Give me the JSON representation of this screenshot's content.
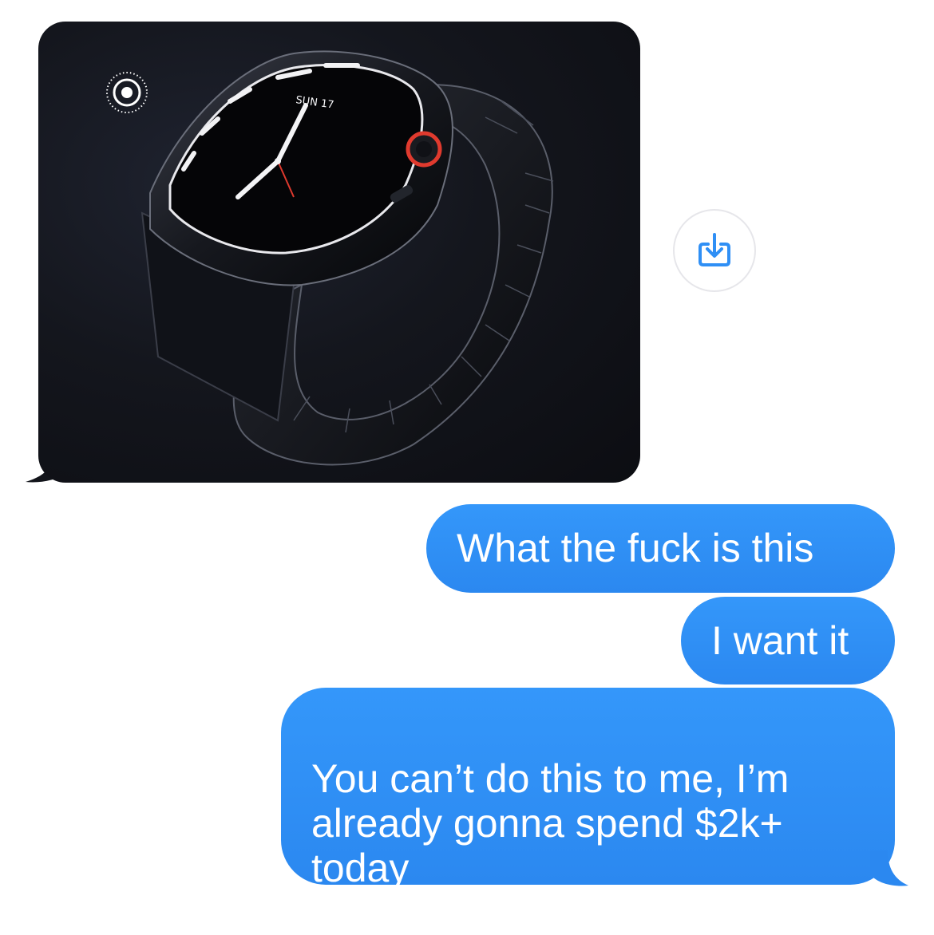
{
  "thread": {
    "incoming_image": {
      "badge": "live-photo-icon",
      "photo_text": "SUN 17"
    },
    "save_button": {
      "icon": "save-download-icon",
      "color": "#2f8ff5"
    },
    "messages": [
      {
        "text": "What the fuck is this"
      },
      {
        "text": "I want it"
      },
      {
        "text": "You can’t do this to me, I’m\nalready gonna spend $2k+\ntoday"
      }
    ]
  },
  "colors": {
    "outgoing_bubble": "#2f8ff5",
    "incoming_bubble": "#e9e9eb",
    "background": "#ffffff"
  }
}
